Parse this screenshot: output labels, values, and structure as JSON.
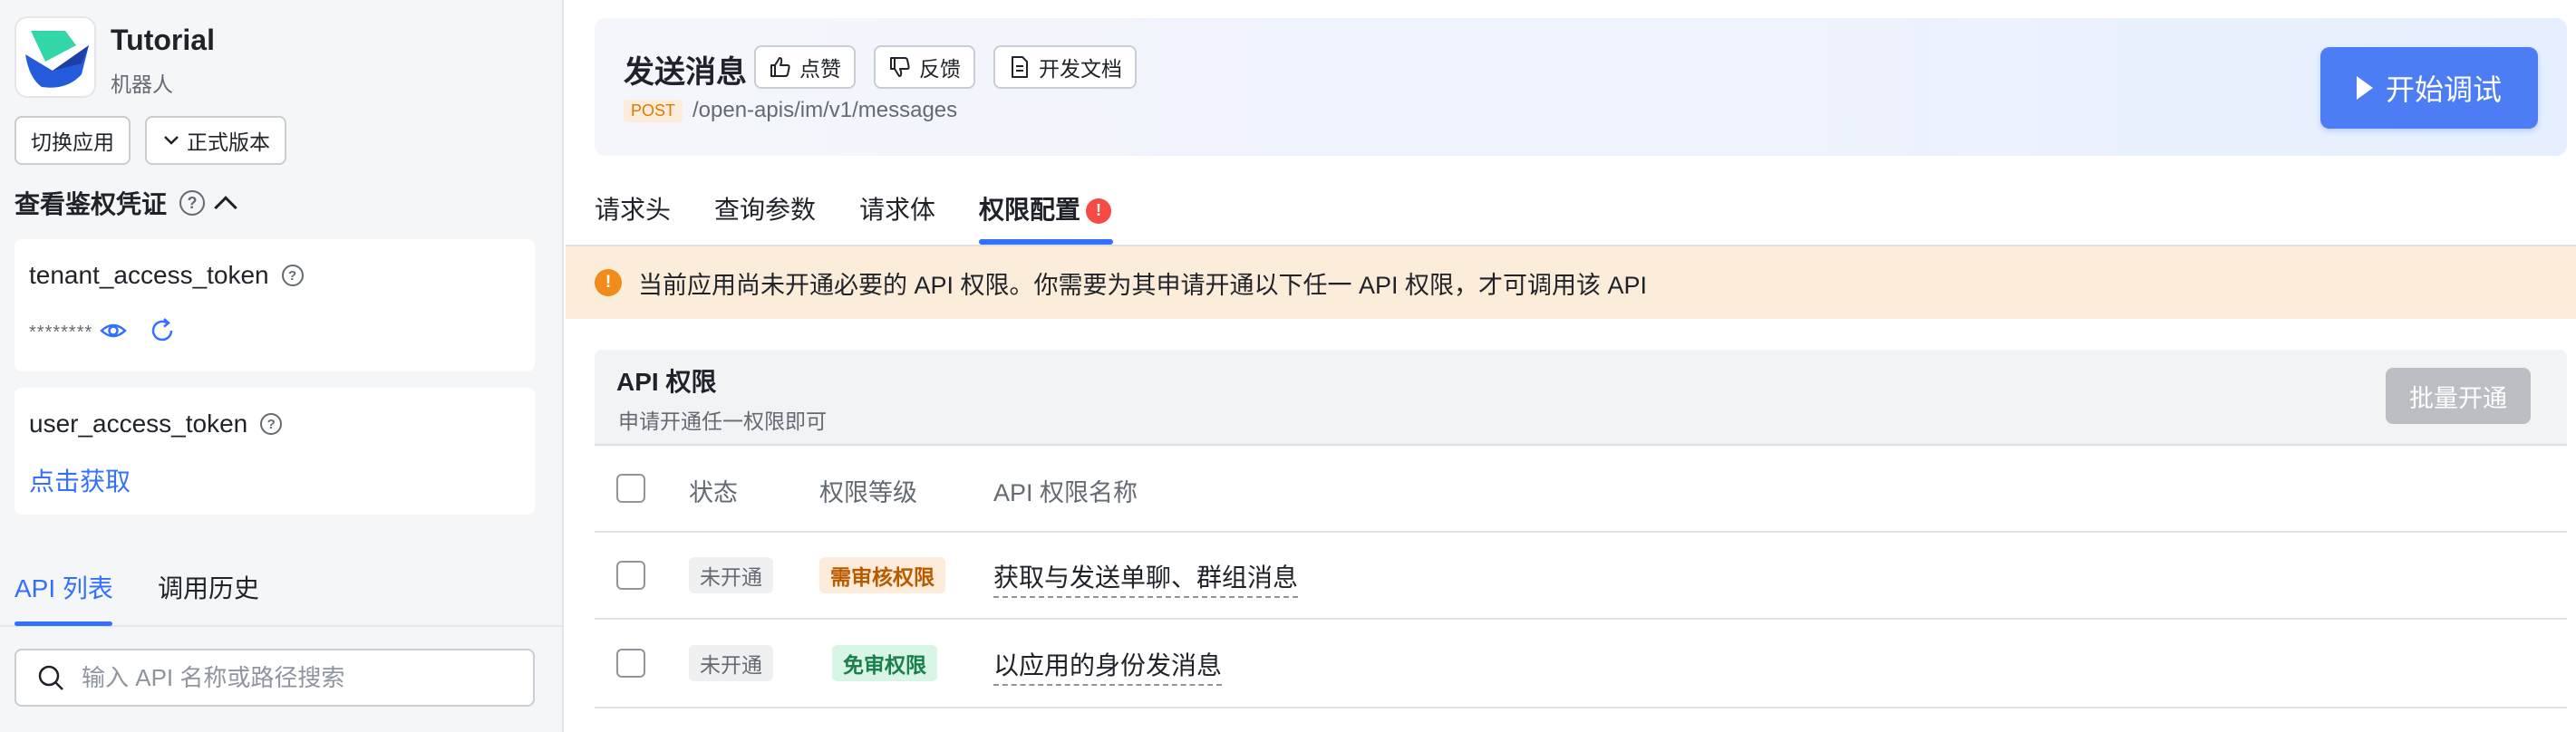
{
  "app": {
    "name": "Tutorial",
    "type": "机器人"
  },
  "sidebar": {
    "switch_app": "切换应用",
    "version": "正式版本",
    "auth_title": "查看鉴权凭证",
    "tenant_token": {
      "label": "tenant_access_token",
      "masked": "********"
    },
    "user_token": {
      "label": "user_access_token",
      "action": "点击获取"
    },
    "tabs": [
      {
        "label": "API 列表",
        "active": true
      },
      {
        "label": "调用历史",
        "active": false
      }
    ],
    "search_placeholder": "输入 API 名称或路径搜索"
  },
  "header": {
    "title": "发送消息",
    "like": "点赞",
    "feedback": "反馈",
    "docs": "开发文档",
    "method": "POST",
    "path": "/open-apis/im/v1/messages",
    "run": "开始调试"
  },
  "tabs": [
    {
      "label": "请求头",
      "active": false
    },
    {
      "label": "查询参数",
      "active": false
    },
    {
      "label": "请求体",
      "active": false
    },
    {
      "label": "权限配置",
      "active": true,
      "badge": "!"
    }
  ],
  "alert": {
    "text": "当前应用尚未开通必要的 API 权限。你需要为其申请开通以下任一 API 权限，才可调用该 API"
  },
  "permissions": {
    "title": "API 权限",
    "subtitle": "申请开通任一权限即可",
    "batch_button": "批量开通",
    "columns": [
      "状态",
      "权限等级",
      "API 权限名称"
    ],
    "rows": [
      {
        "status": "未开通",
        "level": "需审核权限",
        "name": "获取与发送单聊、群组消息"
      },
      {
        "status": "未开通",
        "level": "免审权限",
        "name": "以应用的身份发消息"
      }
    ]
  },
  "colors": {
    "accent": "#3370ff",
    "warning": "#f08c1c",
    "error": "#f54a45"
  }
}
